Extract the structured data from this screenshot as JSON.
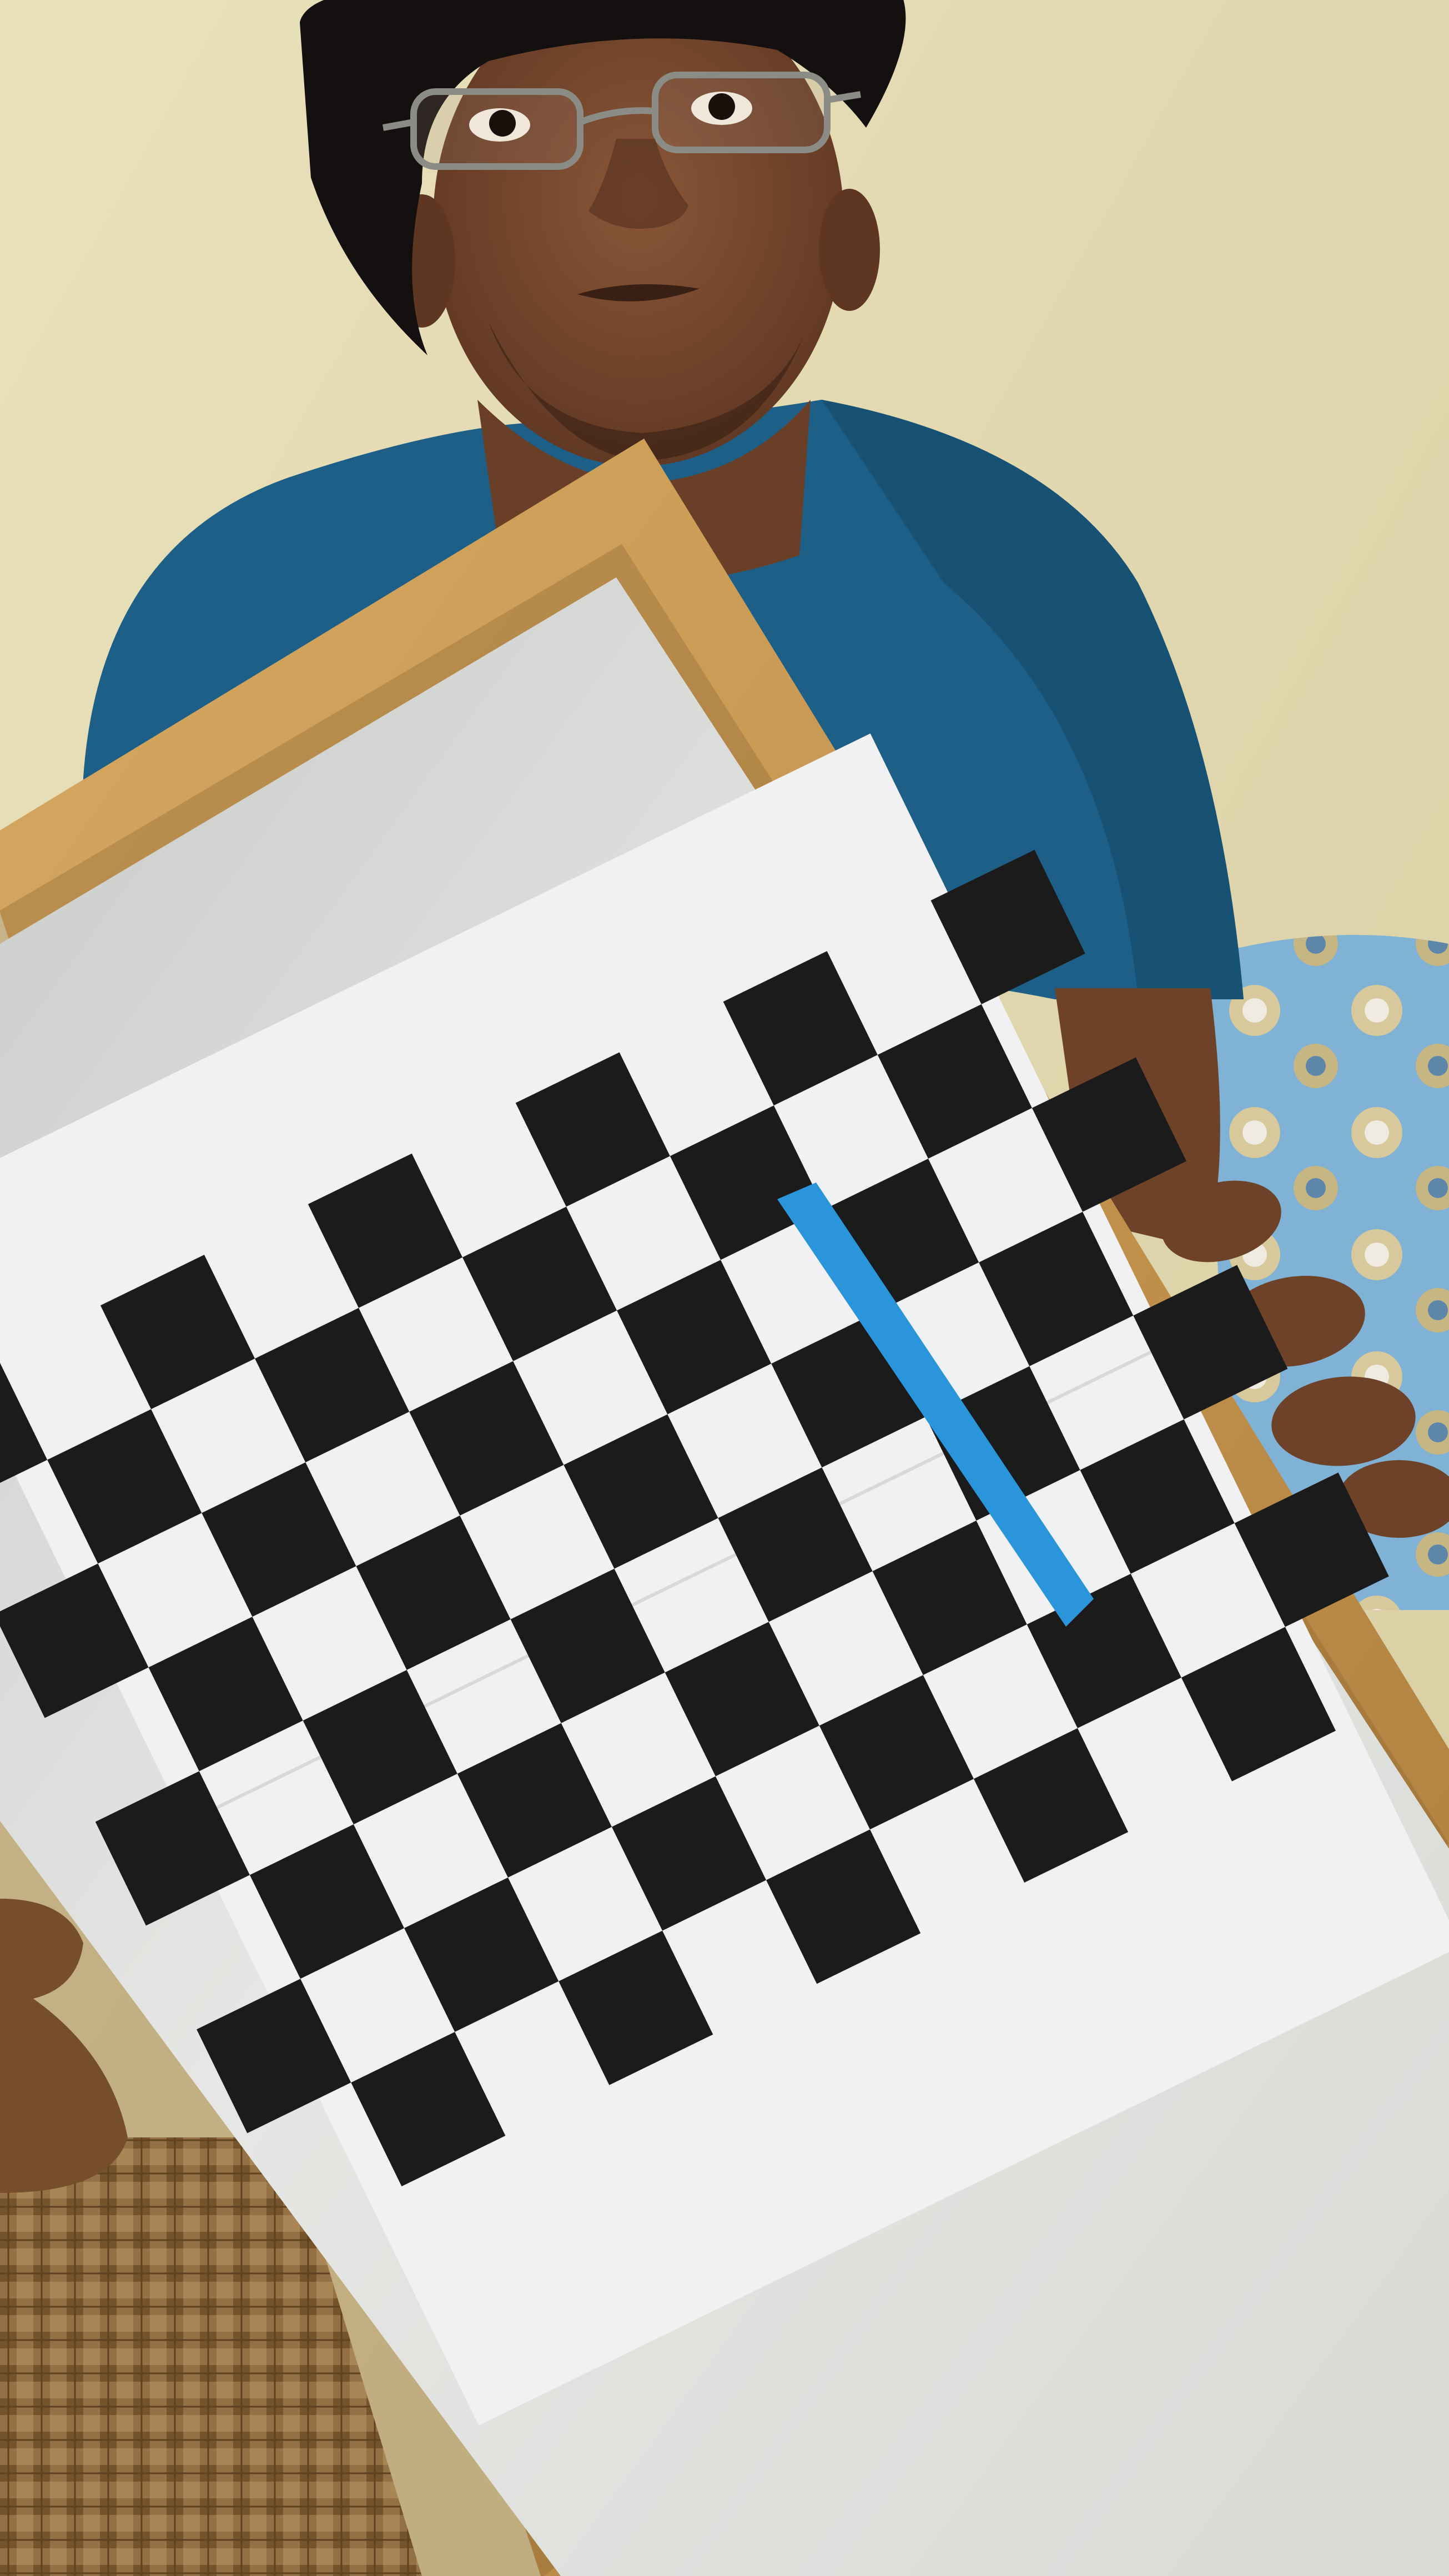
{
  "scene": {
    "colors": {
      "wall": "#e6ddb4",
      "wall_shadow": "#cfc49a",
      "skin": "#7a4a32",
      "skin_dark": "#5a3320",
      "hair": "#141010",
      "shirt": "#1d5f86",
      "shirt_dark": "#144a6a",
      "frame_wood": "#c89a52",
      "frame_wood_dark": "#a77a38",
      "board": "#dedfdc",
      "paper": "#f1f1f3",
      "checker_dark": "#1b1b1b",
      "tape_blue": "#2a95db",
      "cushion": "#6fa8cf",
      "cushion_pattern": "#d9c99b",
      "cloth": "#8a6a44",
      "cloth_dark": "#5c3c22"
    },
    "checkerboard": {
      "rows": 8,
      "cols": 11
    }
  }
}
